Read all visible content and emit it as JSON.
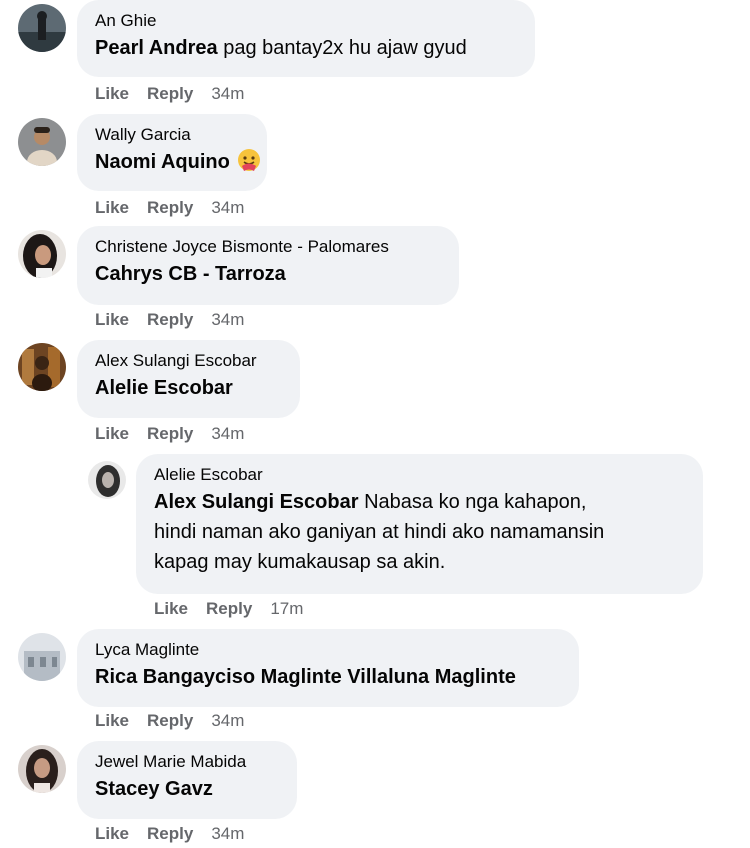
{
  "comments": [
    {
      "author": "An Ghie",
      "mention": "Pearl Andrea",
      "text": " pag bantay2x hu ajaw gyud",
      "actions": {
        "like": "Like",
        "reply": "Reply",
        "time": "34m"
      },
      "avatar_color": "#3f4a52"
    },
    {
      "author": "Wally Garcia",
      "mention": "Naomi Aquino",
      "text": "",
      "emoji": "hug-emoji-icon",
      "actions": {
        "like": "Like",
        "reply": "Reply",
        "time": "34m"
      },
      "avatar_color": "#a08a72"
    },
    {
      "author": "Christene Joyce Bismonte - Palomares",
      "mention": "Cahrys CB - Tarroza",
      "text": "",
      "actions": {
        "like": "Like",
        "reply": "Reply",
        "time": "34m"
      },
      "avatar_color": "#2c2626"
    },
    {
      "author": "Alex Sulangi Escobar",
      "mention": "Alelie Escobar",
      "text": "",
      "actions": {
        "like": "Like",
        "reply": "Reply",
        "time": "34m"
      },
      "avatar_color": "#8a5a2e"
    },
    {
      "author": "Alelie Escobar",
      "mention": "Alex Sulangi Escobar",
      "text_lines": [
        " Nabasa ko nga kahapon,",
        "hindi naman ako ganiyan at hindi ako namamansin",
        "kapag may kumakausap sa akin."
      ],
      "actions": {
        "like": "Like",
        "reply": "Reply",
        "time": "17m"
      },
      "avatar_color": "#6b6b6b",
      "is_reply": true
    },
    {
      "author": "Lyca Maglinte",
      "mention": "Rica Bangayciso Maglinte Villaluna Maglinte",
      "text": "",
      "actions": {
        "like": "Like",
        "reply": "Reply",
        "time": "34m"
      },
      "avatar_color": "#c7ccd3"
    },
    {
      "author": "Jewel Marie Mabida",
      "mention": "Stacey Gavz",
      "text": "",
      "actions": {
        "like": "Like",
        "reply": "Reply",
        "time": "34m"
      },
      "avatar_color": "#4a3a35"
    }
  ]
}
